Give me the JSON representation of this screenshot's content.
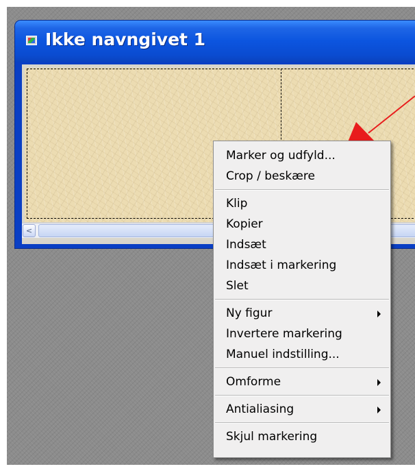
{
  "window": {
    "title": "Ikke navngivet 1",
    "icon": "image-document-icon"
  },
  "scrollbar": {
    "left_arrow": "<"
  },
  "context_menu": {
    "groups": [
      {
        "items": [
          {
            "label": "Marker og udfyld...",
            "submenu": false
          },
          {
            "label": "Crop / beskære",
            "submenu": false
          }
        ]
      },
      {
        "items": [
          {
            "label": "Klip",
            "submenu": false
          },
          {
            "label": "Kopier",
            "submenu": false
          },
          {
            "label": "Indsæt",
            "submenu": false
          },
          {
            "label": "Indsæt i markering",
            "submenu": false
          },
          {
            "label": "Slet",
            "submenu": false
          }
        ]
      },
      {
        "items": [
          {
            "label": "Ny figur",
            "submenu": true
          },
          {
            "label": "Invertere markering",
            "submenu": false
          },
          {
            "label": "Manuel indstilling...",
            "submenu": false
          }
        ]
      },
      {
        "items": [
          {
            "label": "Omforme",
            "submenu": true
          }
        ]
      },
      {
        "items": [
          {
            "label": "Antialiasing",
            "submenu": true
          }
        ]
      },
      {
        "items": [
          {
            "label": "Skjul markering",
            "submenu": false
          }
        ]
      }
    ]
  },
  "colors": {
    "titlebar_blue": "#0c55df",
    "annotation_red": "#e81c1c",
    "canvas_beige": "#ecdcb2",
    "menu_bg": "#f0efef"
  }
}
